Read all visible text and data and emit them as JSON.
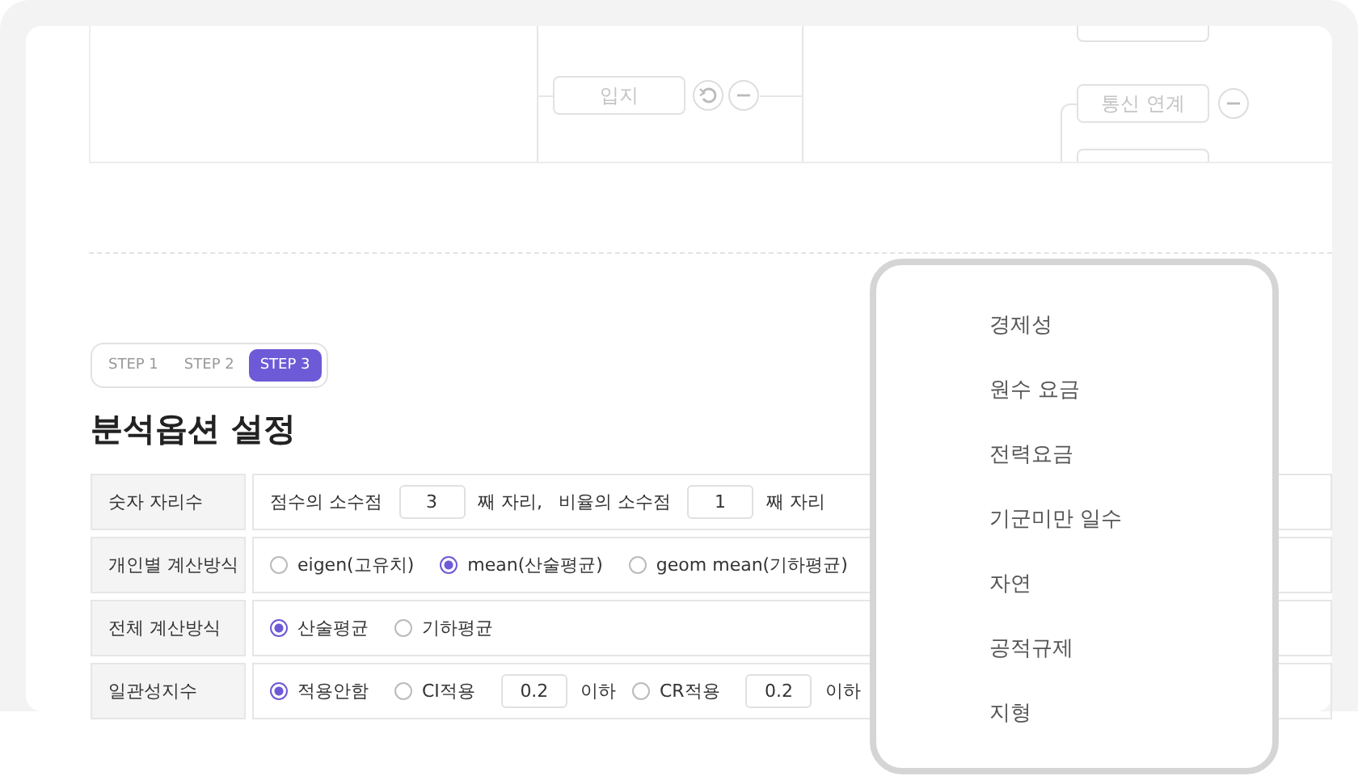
{
  "diagram": {
    "nodes": [
      {
        "label": "입지",
        "kind": "undo"
      },
      {
        "label": "통신 연계",
        "kind": "plain"
      }
    ]
  },
  "steps": [
    {
      "label": "STEP 1",
      "selected": false
    },
    {
      "label": "STEP 2",
      "selected": false
    },
    {
      "label": "STEP 3",
      "selected": true
    }
  ],
  "title": "분석옵션 설정",
  "options": [
    {
      "label": "숫자 자리수",
      "parts": [
        {
          "kind": "text",
          "text": "점수의 소수점"
        },
        {
          "kind": "input",
          "value": "3"
        },
        {
          "kind": "text",
          "text": "째 자리,"
        },
        {
          "kind": "text",
          "text": "비율의 소수점"
        },
        {
          "kind": "input",
          "value": "1"
        },
        {
          "kind": "text",
          "text": "째 자리"
        }
      ]
    },
    {
      "label": "개인별 계산방식",
      "parts": [
        {
          "kind": "radio",
          "label": "eigen(고유치)",
          "selected": false
        },
        {
          "kind": "radio",
          "label": "mean(산술평균)",
          "selected": true
        },
        {
          "kind": "radio",
          "label": "geom mean(기하평균)",
          "selected": false
        }
      ]
    },
    {
      "label": "전체 계산방식",
      "parts": [
        {
          "kind": "radio",
          "label": "산술평균",
          "selected": true
        },
        {
          "kind": "radio",
          "label": "기하평균",
          "selected": false
        }
      ]
    },
    {
      "label": "일관성지수",
      "parts": [
        {
          "kind": "radio",
          "label": "적용안함",
          "selected": true
        },
        {
          "kind": "radio",
          "label": "CI적용",
          "selected": false
        },
        {
          "kind": "input",
          "value": "0.2"
        },
        {
          "kind": "text",
          "text": "이하"
        },
        {
          "kind": "radio",
          "label": "CR적용",
          "selected": false
        },
        {
          "kind": "input",
          "value": "0.2"
        },
        {
          "kind": "text",
          "text": "이하"
        }
      ]
    }
  ],
  "dropdown": {
    "items": [
      "경제성",
      "원수 요금",
      "전력요금",
      "기군미만 일수",
      "자연",
      "공적규제",
      "지형"
    ]
  }
}
